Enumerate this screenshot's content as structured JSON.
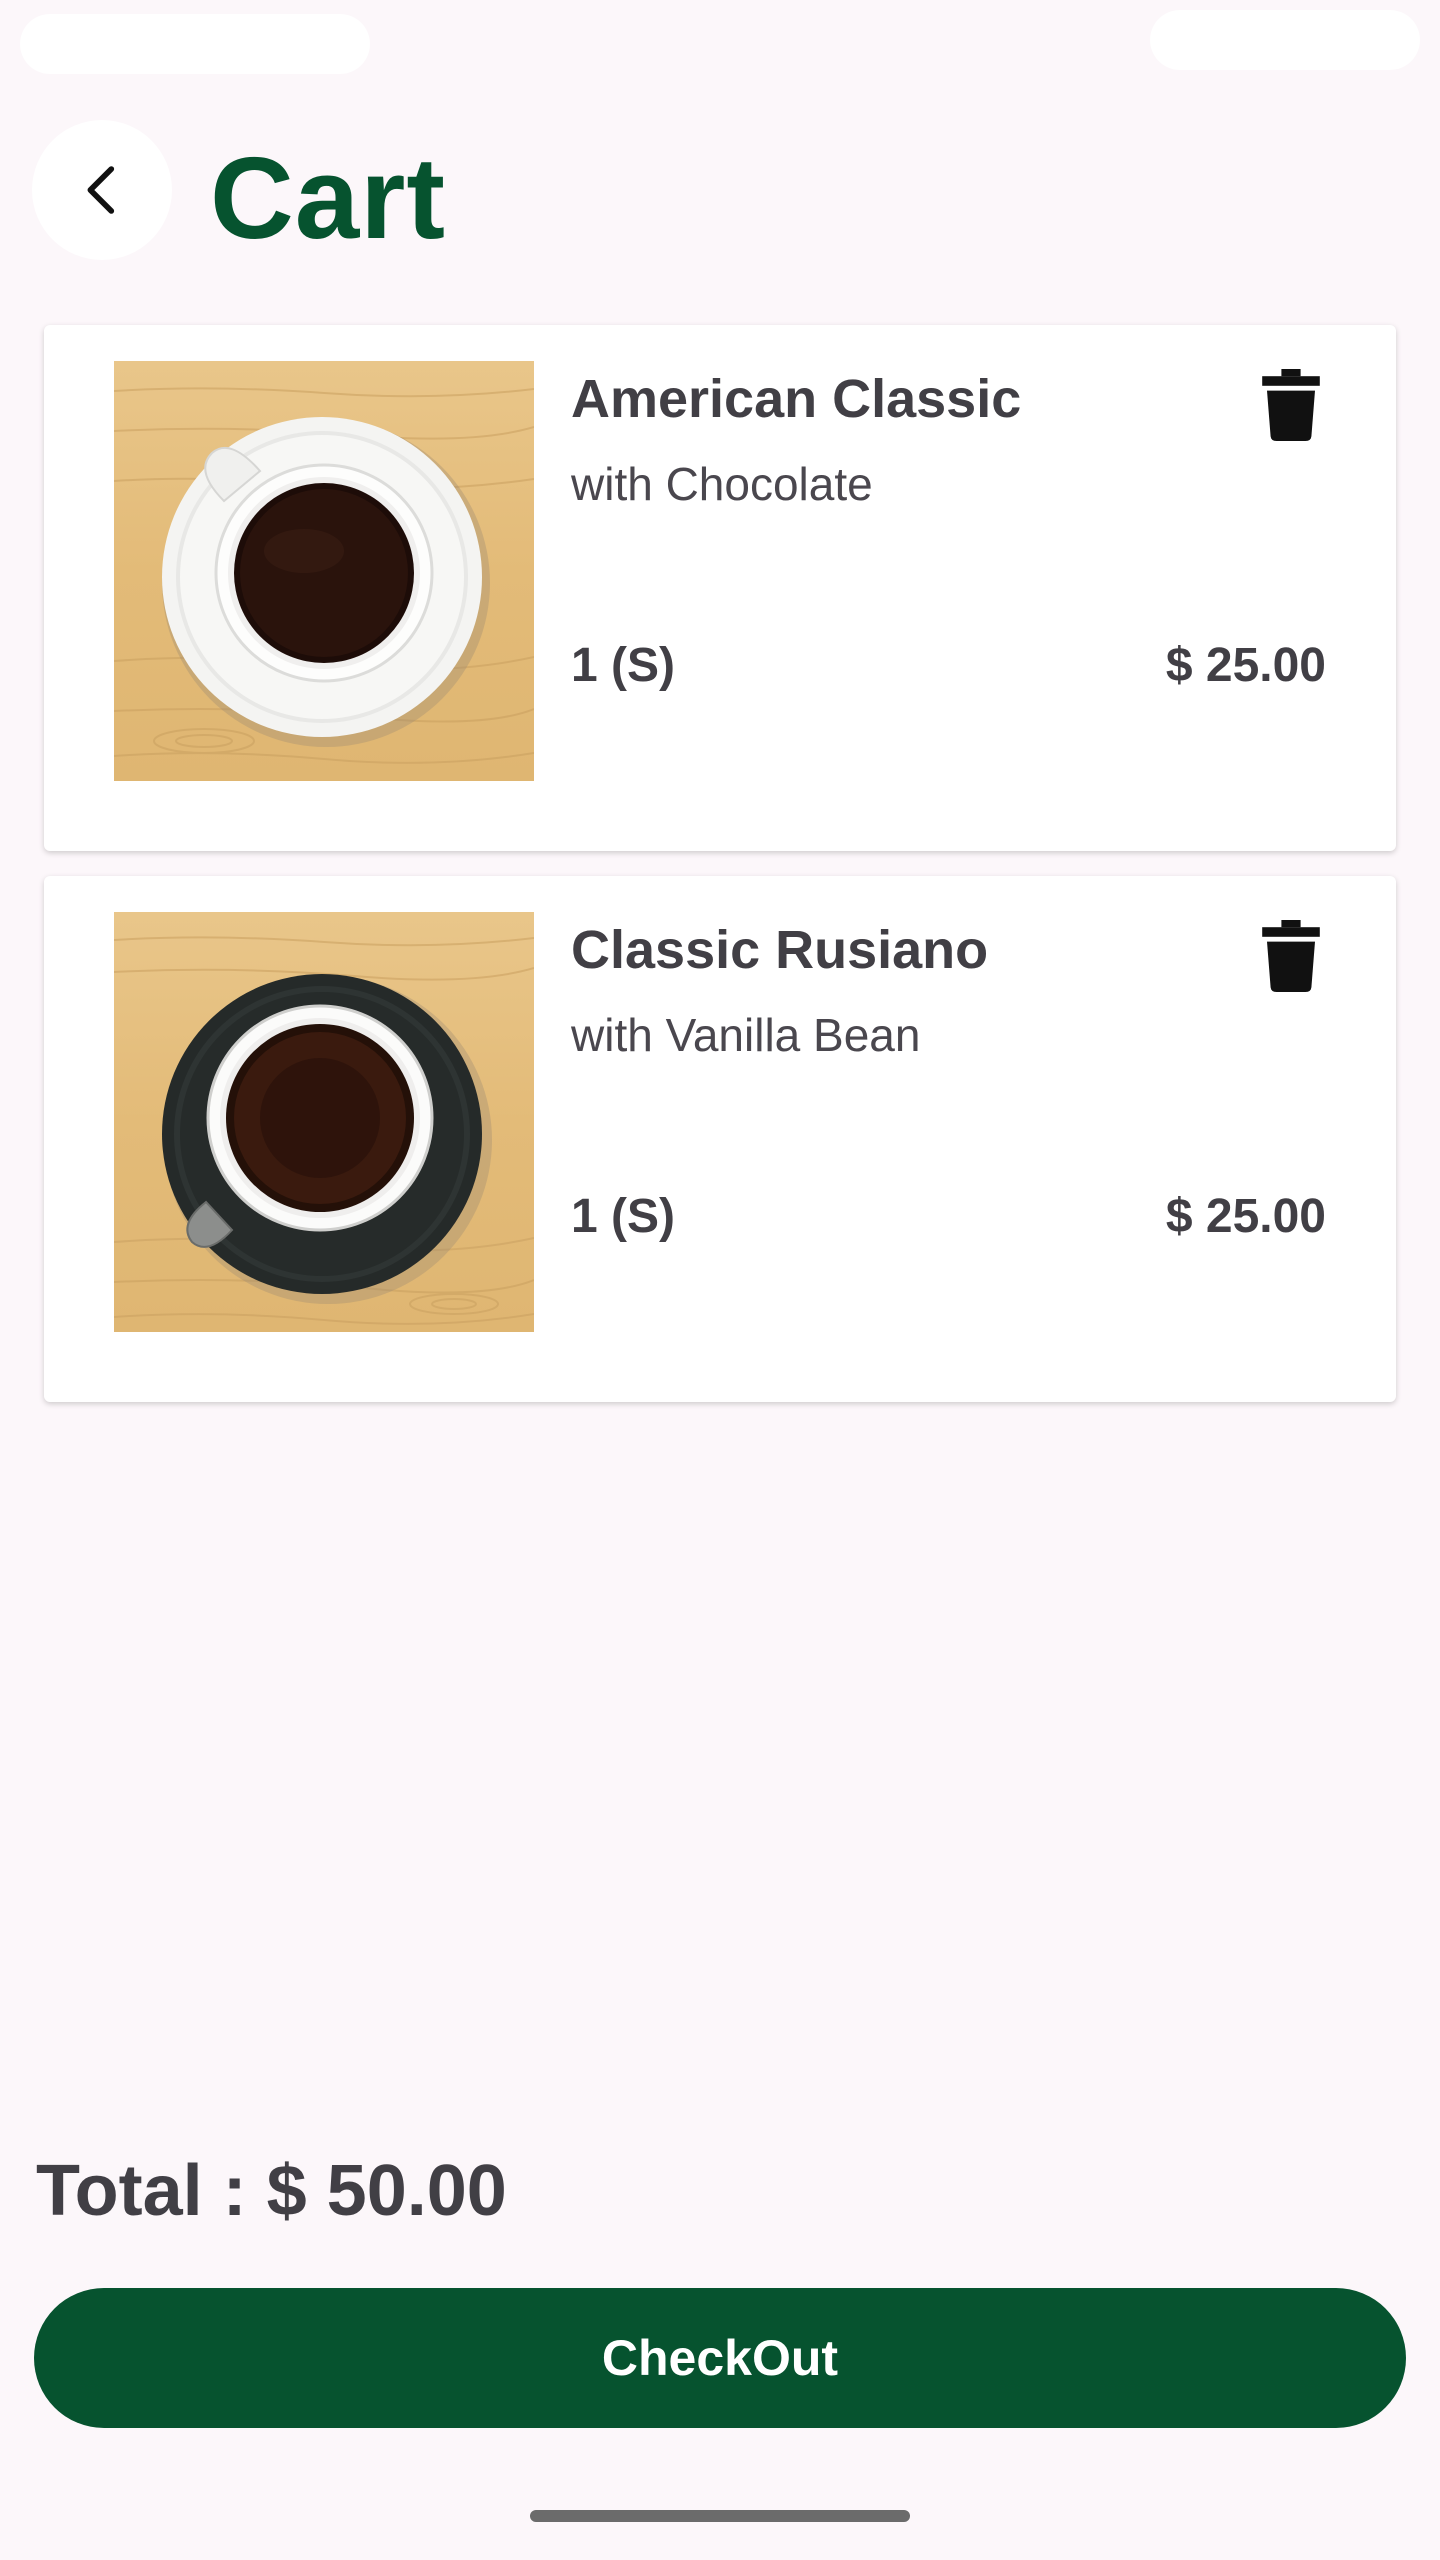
{
  "header": {
    "title": "Cart",
    "back_icon": "chevron-left-icon"
  },
  "cart": {
    "items": [
      {
        "name": "American Classic",
        "variant": "with Chocolate",
        "quantity": "1 (S)",
        "price": "$ 25.00",
        "image": "coffee-cup-white-saucer",
        "delete_icon": "trash-icon"
      },
      {
        "name": "Classic Rusiano",
        "variant": "with Vanilla Bean",
        "quantity": "1 (S)",
        "price": "$ 25.00",
        "image": "coffee-cup-black-saucer",
        "delete_icon": "trash-icon"
      }
    ]
  },
  "summary": {
    "total": "Total : $ 50.00"
  },
  "checkout": {
    "label": "CheckOut"
  },
  "colors": {
    "brand_green": "#06532f",
    "background": "#fcf7fa",
    "text_dark": "#413f45"
  }
}
